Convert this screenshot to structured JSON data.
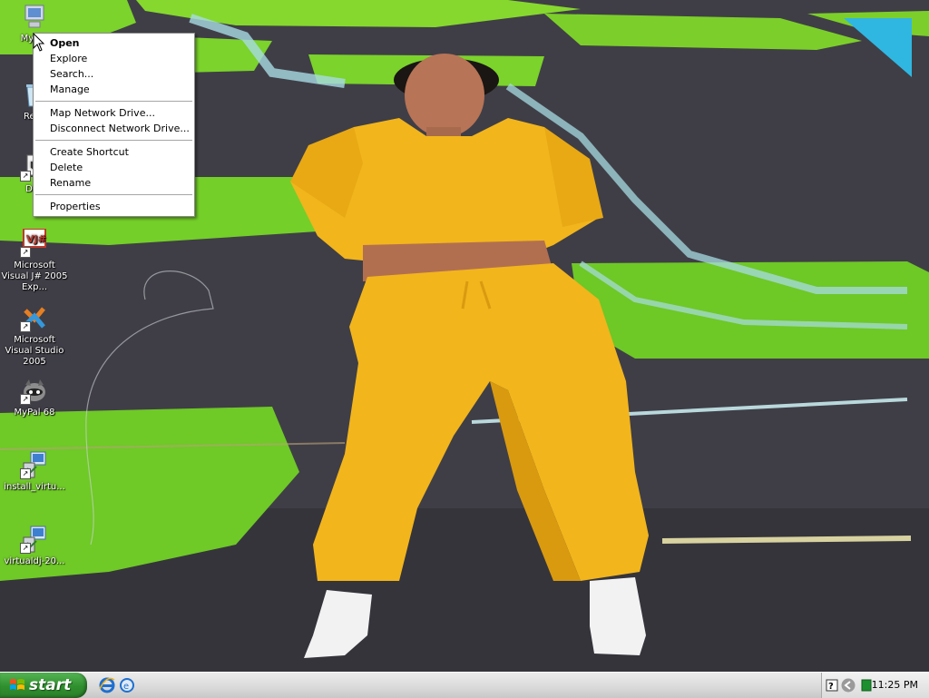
{
  "desktop_icons": [
    {
      "label": "My Co",
      "icon": "my-computer-icon"
    },
    {
      "label": "Recy",
      "icon": "recycle-bin-icon"
    },
    {
      "label": "Dev",
      "icon": "dev-shortcut-icon"
    },
    {
      "label": "Microsoft Visual J# 2005 Exp...",
      "icon": "visual-jsharp-icon",
      "badge": "VJ#"
    },
    {
      "label": "Microsoft Visual Studio 2005",
      "icon": "visual-studio-icon"
    },
    {
      "label": "MyPal 68",
      "icon": "mypal-raccoon-icon"
    },
    {
      "label": "install_virtu...",
      "icon": "installer-icon"
    },
    {
      "label": "virtualdj-20...",
      "icon": "installer-icon"
    }
  ],
  "context_menu": {
    "items": [
      "Open",
      "Explore",
      "Search...",
      "Manage",
      "Map Network Drive...",
      "Disconnect Network Drive...",
      "Create Shortcut",
      "Delete",
      "Rename",
      "Properties"
    ]
  },
  "taskbar": {
    "start_label": "start",
    "quick_launch": [
      "internet-explorer-icon",
      "show-desktop-icon"
    ],
    "tray_icons": [
      "help-icon",
      "chevron-left-icon",
      "network-icon"
    ],
    "clock": "11:25 PM"
  },
  "colors": {
    "start_green": "#3c9a3b",
    "grass_green": "#7bd32b",
    "asphalt": "#3d3c44",
    "sweatsuit_yellow": "#f2b51c"
  }
}
